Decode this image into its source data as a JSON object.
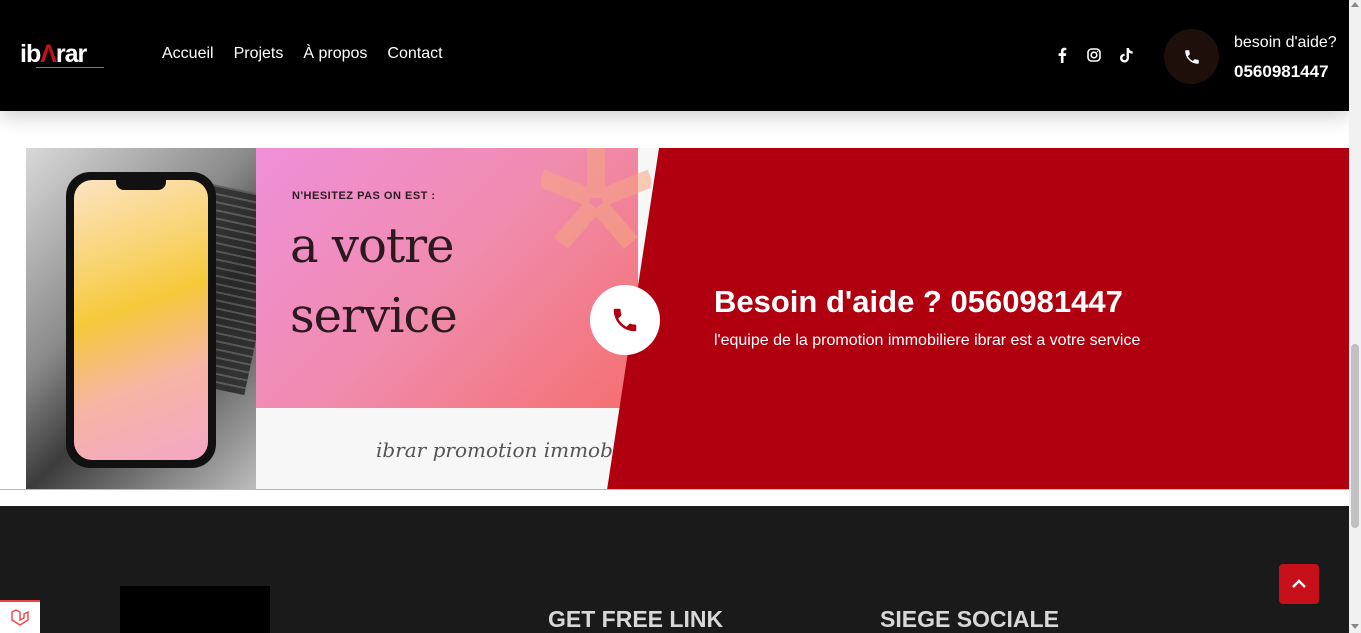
{
  "header": {
    "logo": {
      "part1": "ib",
      "part2": "Λ",
      "part3": "rar"
    },
    "nav": [
      "Accueil",
      "Projets",
      "À propos",
      "Contact"
    ],
    "social": {
      "facebook": "f",
      "instagram": "◎",
      "tiktok": "♪"
    },
    "help_label": "besoin d'aide?",
    "help_number": "0560981447"
  },
  "banner": {
    "card_small": "N'HESITEZ PAS ON EST :",
    "card_big1": "a votre",
    "card_big2": "service",
    "card_bottom": "ibrar promotion immobiliere",
    "title": "Besoin d'aide ? 0560981447",
    "subtitle": "l'equipe de la promotion immobiliere ibrar est a votre service"
  },
  "footer": {
    "heading1": "GET FREE LINK",
    "heading2": "SIEGE SOCIALE"
  },
  "colors": {
    "brand_red": "#b0000f",
    "header_bg": "#000000",
    "footer_bg": "#1a1a1a"
  }
}
